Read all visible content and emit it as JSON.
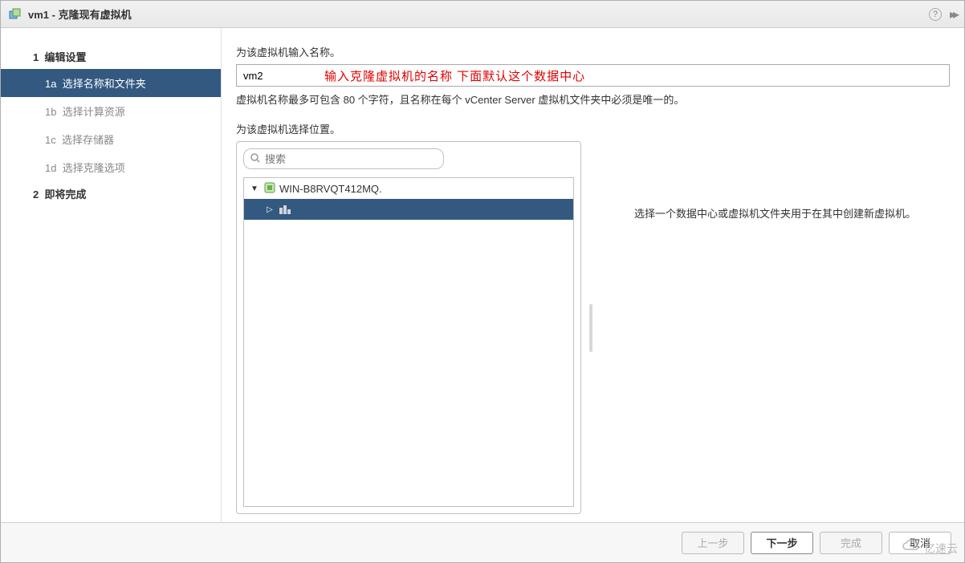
{
  "dialog": {
    "title": "vm1 - 克隆现有虚拟机"
  },
  "sidebar": {
    "steps": [
      {
        "num": "1",
        "label": "编辑设置",
        "type": "header"
      },
      {
        "num": "1a",
        "label": "选择名称和文件夹",
        "type": "item",
        "active": true
      },
      {
        "num": "1b",
        "label": "选择计算资源",
        "type": "item"
      },
      {
        "num": "1c",
        "label": "选择存储器",
        "type": "item"
      },
      {
        "num": "1d",
        "label": "选择克隆选项",
        "type": "item"
      },
      {
        "num": "2",
        "label": "即将完成",
        "type": "header"
      }
    ]
  },
  "main": {
    "name_label": "为该虚拟机输入名称。",
    "name_value": "vm2",
    "annotation": "输入克隆虚拟机的名称    下面默认这个数据中心",
    "name_hint": "虚拟机名称最多可包含 80 个字符，且名称在每个 vCenter Server 虚拟机文件夹中必须是唯一的。",
    "location_label": "为该虚拟机选择位置。",
    "search_placeholder": "搜索",
    "tree": {
      "root": "WIN-B8RVQT412MQ.",
      "child": ""
    },
    "info": "选择一个数据中心或虚拟机文件夹用于在其中创建新虚拟机。"
  },
  "footer": {
    "back": "上一步",
    "next": "下一步",
    "finish": "完成",
    "cancel": "取消"
  },
  "watermark": "亿速云"
}
